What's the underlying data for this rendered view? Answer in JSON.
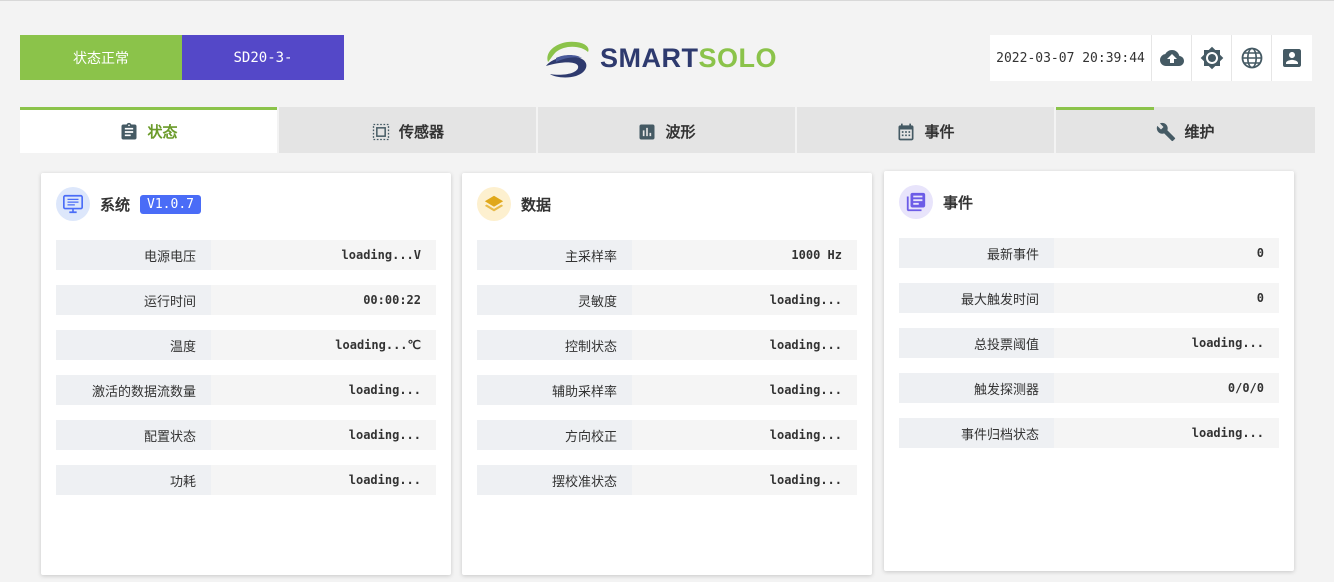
{
  "header": {
    "status_label": "状态正常",
    "device_id": "SD20-3-",
    "logo_smart": "SMART",
    "logo_solo": "SOLO",
    "datetime": "2022-03-07 20:39:44",
    "accent_color": "#8bc34a",
    "device_color": "#5448c8",
    "tools": [
      "cloud-upload-icon",
      "brightness-icon",
      "globe-icon",
      "account-box-icon"
    ]
  },
  "tabs": [
    {
      "label": "状态",
      "icon": "clipboard-icon",
      "active": true
    },
    {
      "label": "传感器",
      "icon": "sensor-chip-icon",
      "active": false
    },
    {
      "label": "波形",
      "icon": "bar-chart-icon",
      "active": false
    },
    {
      "label": "事件",
      "icon": "calendar-icon",
      "active": false
    },
    {
      "label": "维护",
      "icon": "wrench-icon",
      "active": false
    }
  ],
  "panels": {
    "system": {
      "title": "系统",
      "version": "V1.0.7",
      "rows": [
        {
          "label": "电源电压",
          "value": "loading...V"
        },
        {
          "label": "运行时间",
          "value": "00:00:22"
        },
        {
          "label": "温度",
          "value": "loading...℃"
        },
        {
          "label": "激活的数据流数量",
          "value": "loading..."
        },
        {
          "label": "配置状态",
          "value": "loading..."
        },
        {
          "label": "功耗",
          "value": "loading..."
        }
      ]
    },
    "data": {
      "title": "数据",
      "rows": [
        {
          "label": "主采样率",
          "value": "1000 Hz"
        },
        {
          "label": "灵敏度",
          "value": "loading..."
        },
        {
          "label": "控制状态",
          "value": "loading..."
        },
        {
          "label": "辅助采样率",
          "value": "loading..."
        },
        {
          "label": "方向校正",
          "value": "loading..."
        },
        {
          "label": "摆校准状态",
          "value": "loading..."
        }
      ]
    },
    "events": {
      "title": "事件",
      "rows": [
        {
          "label": "最新事件",
          "value": "0"
        },
        {
          "label": "最大触发时间",
          "value": "0"
        },
        {
          "label": "总投票阈值",
          "value": "loading..."
        },
        {
          "label": "触发探测器",
          "value": "0/0/0"
        },
        {
          "label": "事件归档状态",
          "value": "loading..."
        }
      ]
    }
  }
}
